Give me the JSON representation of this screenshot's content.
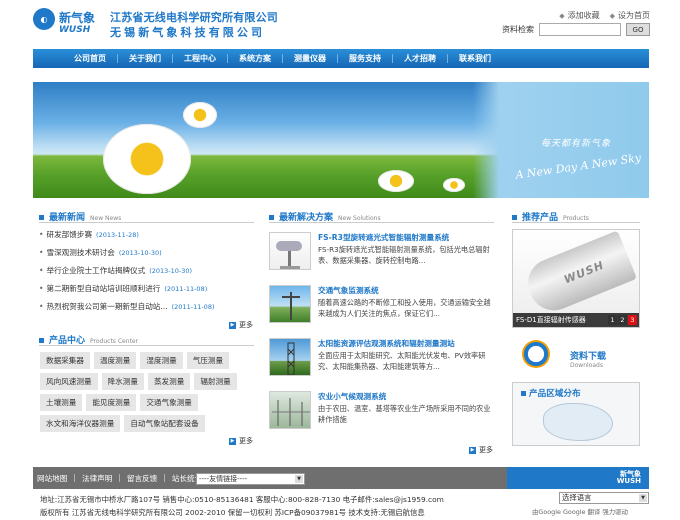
{
  "header": {
    "logo_cn": "新气象",
    "logo_en": "WUSH",
    "company_cn": "江苏省无线电科学研究所有限公司",
    "company_cn2": "无锡新气象科技有限公司",
    "add_favorite": "添加收藏",
    "set_home": "设为首页",
    "search_label": "资料检索",
    "search_value": "",
    "search_button": "GO"
  },
  "nav": [
    "公司首页",
    "关于我们",
    "工程中心",
    "系统方案",
    "测量仪器",
    "服务支持",
    "人才招聘",
    "联系我们"
  ],
  "banner": {
    "slogan_cn": "每天都有新气象",
    "slogan_en": "A New Day A New Sky"
  },
  "news": {
    "title": "最新新闻",
    "title_en": "New News",
    "items": [
      {
        "text": "研发部馈步赛",
        "date": "(2013-11-28)"
      },
      {
        "text": "雪深观测技术研讨会",
        "date": "(2013-10-30)"
      },
      {
        "text": "举行企业院士工作站揭牌仪式",
        "date": "(2013-10-30)"
      },
      {
        "text": "第二期新型自动站培训班顺利进行",
        "date": "(2011-11-08)"
      },
      {
        "text": "热烈祝贺我公司第一期新型自动站...",
        "date": "(2011-11-08)"
      }
    ],
    "more": "更多"
  },
  "products": {
    "title": "产品中心",
    "title_en": "Products Center",
    "rows": [
      [
        "数据采集器",
        "温度测量",
        "湿度测量",
        "气压测量"
      ],
      [
        "风向风速测量",
        "降水测量",
        "蒸发测量",
        "辐射测量"
      ],
      [
        "土壤测量",
        "能见度测量",
        "交通气象测量"
      ],
      [
        "水文和海洋仪器测量",
        "自动气象站配套设备"
      ]
    ],
    "more": "更多"
  },
  "solutions": {
    "title": "最新解决方案",
    "title_en": "New Solutions",
    "items": [
      {
        "title": "FS-R3型旋转遮光式智能辐射测量系统",
        "desc": "FS-R3旋转遮光式智能辐射测量系统，包括光电总辐射表、数据采集器、旋转控制电路..."
      },
      {
        "title": "交通气象监测系统",
        "desc": "随着高速公路的不断修工和投入使用，交通运输安全越来越成为人们关注的焦点，保证它们..."
      },
      {
        "title": "太阳能资源评估观测系统和辐射测量测站",
        "desc": "全面应用于太阳能研究、太阳能光伏发电、PV效率研究、太阳能集热器、太阳能建筑等方..."
      },
      {
        "title": "农业小气候观测系统",
        "desc": "由于农田、温室、基塔等农业生产场所采用不同的农业耕作措施"
      }
    ],
    "more": "更多"
  },
  "recommended": {
    "title": "推荐产品",
    "title_en": "Products",
    "brand": "WUSH",
    "caption": "FS-D1直接辐射传感器",
    "pages": [
      "1",
      "2",
      "3"
    ]
  },
  "download": {
    "title": "资料下载",
    "title_en": "Downloads"
  },
  "distribution": {
    "title": "产品区域分布"
  },
  "footer": {
    "links": [
      "网站地图",
      "法律声明",
      "留言反馈",
      "站长统计"
    ],
    "friend_links": "----友情链接----",
    "logo_cn": "新气象",
    "logo_en": "WUSH",
    "address": "地址:江苏省无锡市中桥水厂路107号 销售中心:0510-85136481 客服中心:800-828-7130 电子邮件:sales@js1959.com",
    "copyright": "版权所有 江苏省无线电科学研究所有限公司 2002-2010 保留一切权利 苏ICP备09037981号 技术支持:无锡启航信息",
    "language": "选择语言",
    "google_note": "由Google Google 翻译 强力驱动"
  }
}
